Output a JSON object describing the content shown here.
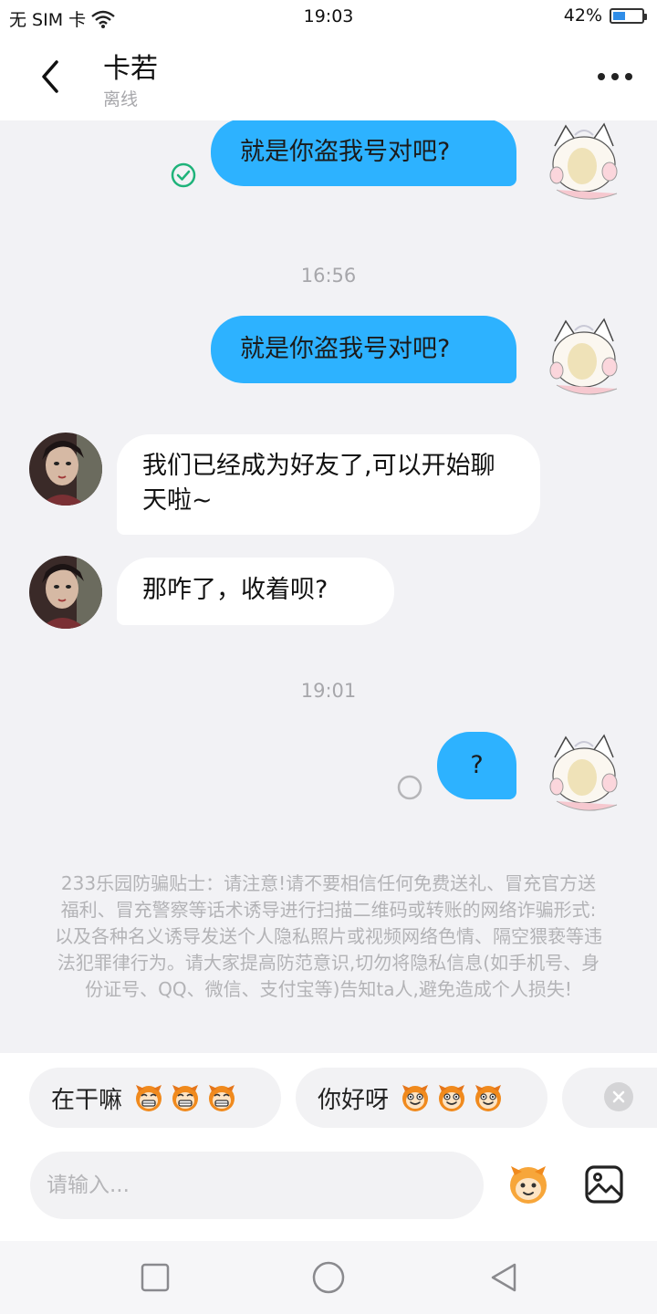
{
  "status_bar": {
    "carrier": "无 SIM 卡",
    "time": "19:03",
    "battery": "42%",
    "battery_level": 0.42
  },
  "header": {
    "contact_name": "卡若",
    "contact_status": "离线"
  },
  "messages": [
    {
      "direction": "out",
      "text": "就是你盗我号对吧?",
      "status": "sent-check"
    },
    {
      "type": "time",
      "text": "16:56"
    },
    {
      "direction": "out",
      "text": "就是你盗我号对吧?"
    },
    {
      "direction": "in",
      "text": "我们已经成为好友了,可以开始聊天啦~"
    },
    {
      "direction": "in",
      "text": "那咋了，收着呗?"
    },
    {
      "type": "time",
      "text": "19:01"
    },
    {
      "direction": "out",
      "text": "?",
      "status": "pending-circle"
    }
  ],
  "safety_tip": "233乐园防骗贴士：请注意!请不要相信任何免费送礼、冒充官方送福利、冒充警察等话术诱导进行扫描二维码或转账的网络诈骗形式:以及各种名义诱导发送个人隐私照片或视频网络色情、隔空猥亵等违法犯罪律行为。请大家提高防范意识,切勿将隐私信息(如手机号、身份证号、QQ、微信、支付宝等)告知ta人,避免造成个人损失!",
  "quick_replies": [
    {
      "text": "在干嘛",
      "emoji_count": 3
    },
    {
      "text": "你好呀",
      "emoji_count": 3
    }
  ],
  "input": {
    "placeholder": "请输入..."
  },
  "colors": {
    "outgoing_bubble": "#2db2ff",
    "incoming_bubble": "#ffffff",
    "chat_background": "#f2f2f5",
    "check_green": "#1fb37a"
  },
  "icons": [
    "back-arrow-icon",
    "more-dots-icon",
    "check-circle-icon",
    "pending-circle-icon",
    "emoji-monkey-icon",
    "image-icon",
    "close-icon",
    "nav-square-icon",
    "nav-circle-icon",
    "nav-triangle-icon",
    "wifi-icon",
    "battery-icon"
  ]
}
